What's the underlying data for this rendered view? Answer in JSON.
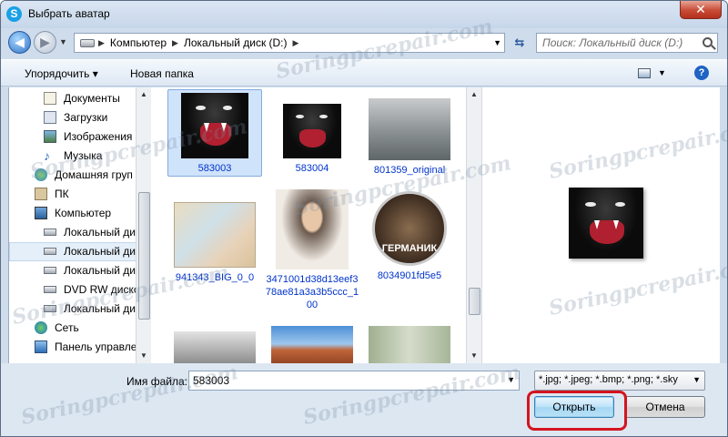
{
  "window": {
    "title": "Выбрать аватар",
    "app_icon": "skype-icon",
    "close_glyph": "✕"
  },
  "nav": {
    "back_glyph": "◀",
    "forward_glyph": "▶",
    "crumbs": [
      "Компьютер",
      "Локальный диск (D:)"
    ],
    "search_placeholder": "Поиск: Локальный диск (D:)"
  },
  "toolbar": {
    "organize": "Упорядочить ▾",
    "new_folder": "Новая папка",
    "help": "?"
  },
  "sidebar": {
    "items": [
      {
        "label": "Документы",
        "icon": "documents-icon"
      },
      {
        "label": "Загрузки",
        "icon": "downloads-icon"
      },
      {
        "label": "Изображения",
        "icon": "pictures-icon"
      },
      {
        "label": "Музыка",
        "icon": "music-icon"
      },
      {
        "label": "Домашняя груп",
        "icon": "homegroup-icon"
      },
      {
        "label": "ПК",
        "icon": "pc-icon"
      },
      {
        "label": "Компьютер",
        "icon": "computer-icon"
      },
      {
        "label": "Локальный ди",
        "icon": "drive-icon"
      },
      {
        "label": "Локальный ди",
        "icon": "drive-icon"
      },
      {
        "label": "Локальный ди",
        "icon": "drive-icon"
      },
      {
        "label": "DVD RW диско",
        "icon": "dvd-icon"
      },
      {
        "label": "Локальный ди",
        "icon": "drive-icon"
      },
      {
        "label": "Сеть",
        "icon": "network-icon"
      },
      {
        "label": "Панель управле",
        "icon": "control-panel-icon"
      }
    ]
  },
  "files": [
    {
      "name": "583003",
      "selected": true
    },
    {
      "name": "583004"
    },
    {
      "name": "801359_original"
    },
    {
      "name": "941343_BIG_0_0"
    },
    {
      "name": "3471001d38d13eef378ae81a3a3b5ccc_100"
    },
    {
      "name": "8034901fd5e5",
      "thumb_text": "ГЕРМАНИК"
    }
  ],
  "footer": {
    "filename_label": "Имя файла:",
    "filename_value": "583003",
    "filter_value": "*.jpg; *.jpeg; *.bmp; *.png; *.sky",
    "open_button": "Открыть",
    "cancel_button": "Отмена"
  },
  "watermark": "Soringpcrepair.com",
  "colors": {
    "highlight_ring": "#d4141e",
    "link_text": "#0033cc"
  }
}
